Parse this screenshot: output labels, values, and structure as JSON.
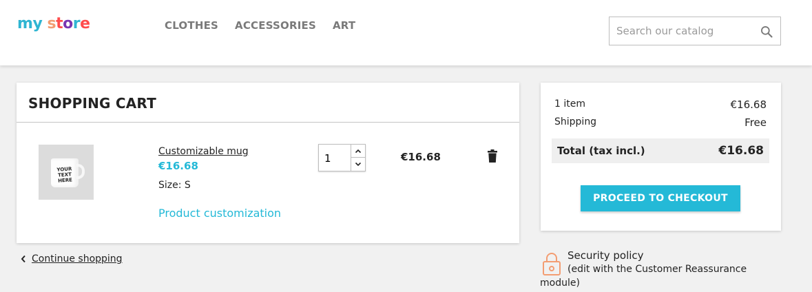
{
  "header": {
    "logo_letters": [
      {
        "ch": "m",
        "color": "#2fb5d2"
      },
      {
        "ch": "y",
        "color": "#2fb5d2"
      },
      {
        "ch": " ",
        "color": "#2fb5d2"
      },
      {
        "ch": "s",
        "color": "#f39d72"
      },
      {
        "ch": "t",
        "color": "#ff4c4c"
      },
      {
        "ch": "o",
        "color": "#7a35b1"
      },
      {
        "ch": "r",
        "color": "#2fb5d2"
      },
      {
        "ch": "e",
        "color": "#ff4c4c"
      }
    ],
    "nav": [
      {
        "label": "CLOTHES"
      },
      {
        "label": "ACCESSORIES"
      },
      {
        "label": "ART"
      }
    ],
    "search": {
      "placeholder": "Search our catalog",
      "value": "",
      "icon": "search-icon"
    }
  },
  "cart": {
    "title": "SHOPPING CART",
    "item": {
      "thumbnail_text": "YOUR TEXT HERE",
      "name": "Customizable mug",
      "price": "€16.68",
      "size_label": "Size:",
      "size_value": "S",
      "customization_link": "Product customization",
      "quantity": "1",
      "line_total": "€16.68",
      "delete_icon": "trash-icon"
    },
    "continue_label": "Continue shopping"
  },
  "summary": {
    "items_label": "1 item",
    "items_value": "€16.68",
    "shipping_label": "Shipping",
    "shipping_value": "Free",
    "total_label": "Total (tax incl.)",
    "total_value": "€16.68",
    "checkout_label": "PROCEED TO CHECKOUT"
  },
  "reassurance": {
    "icon": "lock-icon",
    "title": "Security policy",
    "desc_line1": "(edit with the Customer Reassurance",
    "desc_line2": "module)"
  },
  "colors": {
    "accent": "#24b9d7",
    "text": "#232323",
    "background": "#f1f1f1",
    "lock_icon": "#f39d72"
  }
}
